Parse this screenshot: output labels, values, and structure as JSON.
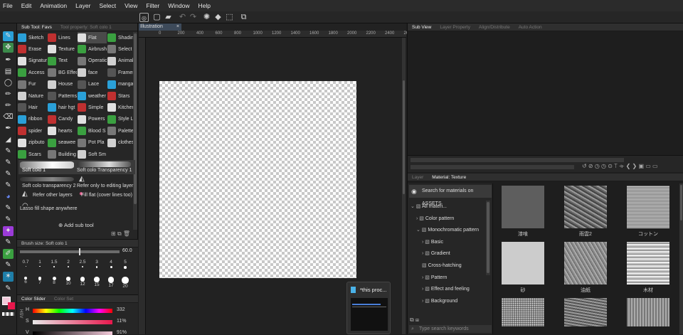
{
  "menu": [
    "File",
    "Edit",
    "Animation",
    "Layer",
    "Select",
    "View",
    "Filter",
    "Window",
    "Help"
  ],
  "subtool": {
    "tabs": [
      "Sub Tool: Favs",
      "Tool property: Soft colo 1"
    ],
    "groups": [
      [
        "Sketch",
        "Lines",
        "Flat",
        "Shading"
      ],
      [
        "Erase",
        "Texture",
        "Airbrush",
        "Select"
      ],
      [
        "Signature",
        "Text",
        "Operation",
        "Animal"
      ],
      [
        "Access",
        "BG Effect",
        "face",
        "Frames"
      ],
      [
        "Fur",
        "House",
        "Lace",
        "manga"
      ],
      [
        "Nature",
        "Patterns",
        "weather",
        "Stars"
      ],
      [
        "Hair",
        "hair hgt",
        "Simple",
        "Kitchen"
      ],
      [
        "ribbon",
        "Candy",
        "Powers",
        "Style Li"
      ],
      [
        "spider",
        "hearts",
        "Blood S",
        "Palettes"
      ],
      [
        "zipbuto",
        "seawee",
        "Pot Pla",
        "clothes"
      ],
      [
        "Scars",
        "Building",
        "Soft Sm",
        ""
      ]
    ],
    "brushes": [
      "Soft colo 1",
      "Soft colo Transparency 1",
      "Soft colo transparency 2",
      "Refer only to editing layer",
      "Refer other layers",
      "Fill flat (cover lines too)",
      "Lasso fill shape anywhere"
    ],
    "add_label": "Add sub tool"
  },
  "brushsize": {
    "title": "Brush size: Soft colo 1",
    "value": "60.0",
    "sizes": [
      "0.7",
      "1",
      "1.5",
      "2",
      "2.5",
      "3",
      "4",
      "5",
      "6",
      "7",
      "8",
      "10",
      "12",
      "15",
      "17",
      "20"
    ]
  },
  "colorslider": {
    "tabs": [
      "Color Slider",
      "Color Set"
    ],
    "rows": [
      {
        "label": "H",
        "value": "332"
      },
      {
        "label": "S",
        "value": "11%"
      },
      {
        "label": "V",
        "value": "91%"
      }
    ],
    "mode": "HSV"
  },
  "canvas": {
    "tab": "Illustration",
    "ruler": [
      "0",
      "200",
      "400",
      "600",
      "800",
      "1000",
      "1200",
      "1400",
      "1600",
      "1800",
      "2000",
      "2200",
      "2400",
      "2600"
    ]
  },
  "popup": {
    "title": "*this proc..."
  },
  "rightpanel": {
    "tabs": [
      "Sub View",
      "Layer Property",
      "Align/Distribute",
      "Auto Action"
    ],
    "material_tabs": [
      "Layer",
      "Material: Texture"
    ],
    "search_assets": "Search for materials on ASSETS",
    "tree": [
      "All materi...",
      "Color pattern",
      "Monochromatic pattern",
      "Basic",
      "Gradient",
      "Cross-hatching",
      "Pattern",
      "Effect and feeling",
      "Background"
    ],
    "search_placeholder": "Type search keywords",
    "thumbs": [
      "漆喰",
      "雨雲2",
      "コットン",
      "砂",
      "油紙",
      "木材"
    ]
  }
}
